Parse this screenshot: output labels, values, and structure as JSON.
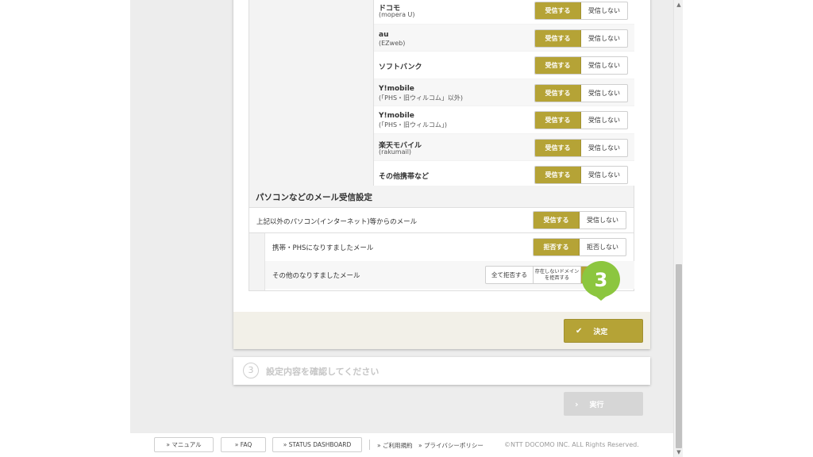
{
  "carriers": [
    {
      "name": "ドコモ",
      "sub": "(mopera U)"
    },
    {
      "name": "au",
      "sub": "(EZweb)"
    },
    {
      "name": "ソフトバンク",
      "sub": ""
    },
    {
      "name": "Y!mobile",
      "sub": "(「PHS・旧ウィルコム」以外)"
    },
    {
      "name": "Y!mobile",
      "sub": "(「PHS・旧ウィルコム」)"
    },
    {
      "name": "楽天モバイル",
      "sub": "(rakumail)"
    },
    {
      "name": "その他携帯など",
      "sub": ""
    }
  ],
  "toggle": {
    "accept": "受信する",
    "reject": "受信しない"
  },
  "pc_section": {
    "title": "パソコンなどのメール受信設定",
    "other_pc_label": "上記以外のパソコン(インターネット)等からのメール",
    "spoof_mobile_label": "携帯・PHSになりすましたメール",
    "spoof_mobile_on": "拒否する",
    "spoof_mobile_off": "拒否しない",
    "spoof_other_label": "その他のなりすましたメール",
    "spoof_other_opt1": "全て拒否する",
    "spoof_other_opt2": "存在しないドメイン を拒否する"
  },
  "marker": {
    "number": "3",
    "color": "#8cc63f"
  },
  "confirm_button": "決定",
  "step": {
    "number": "3",
    "title": "設定内容を確認してください"
  },
  "execute_button": "実行",
  "footer": {
    "manual": "» マニュアル",
    "faq": "» FAQ",
    "status": "» STATUS DASHBOARD",
    "terms": "» ご利用規約",
    "privacy": "» プライバシーポリシー",
    "copyright": "©NTT DOCOMO INC. ALL Rights Reserved."
  },
  "colors": {
    "accent": "#b5a336",
    "disabled": "#d6d6d6"
  }
}
